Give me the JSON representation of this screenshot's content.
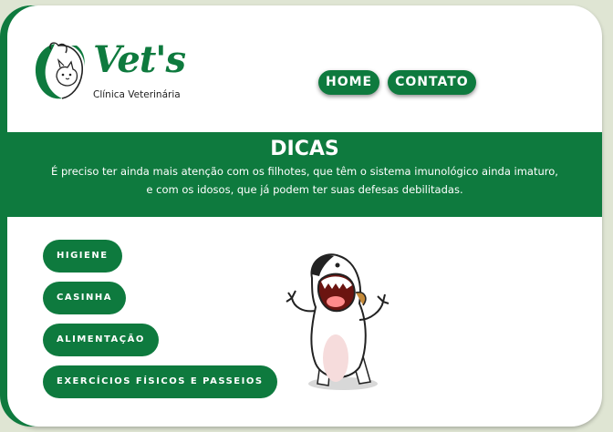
{
  "brand": {
    "name": "Vet's",
    "subtitle": "Clínica Veterinária"
  },
  "nav": {
    "items": [
      {
        "label": "HOME"
      },
      {
        "label": "CONTATO"
      }
    ]
  },
  "banner": {
    "title": "DICAS",
    "text_line1": "É preciso ter ainda mais atenção com os filhotes, que têm o sistema imunológico ainda imaturo,",
    "text_line2": "e com os idosos, que já podem ter suas defesas debilitadas."
  },
  "tips": {
    "items": [
      {
        "label": "HIGIENE"
      },
      {
        "label": "CASINHA"
      },
      {
        "label": "ALIMENTAÇÃO"
      },
      {
        "label": "EXERCÍCIOS FÍSICOS E PASSEIOS"
      }
    ]
  },
  "colors": {
    "brand_green": "#0e7a3e",
    "background": "#dfe5d3",
    "card": "#ffffff"
  },
  "illustration": "cartoon-dog-yelling-icon"
}
